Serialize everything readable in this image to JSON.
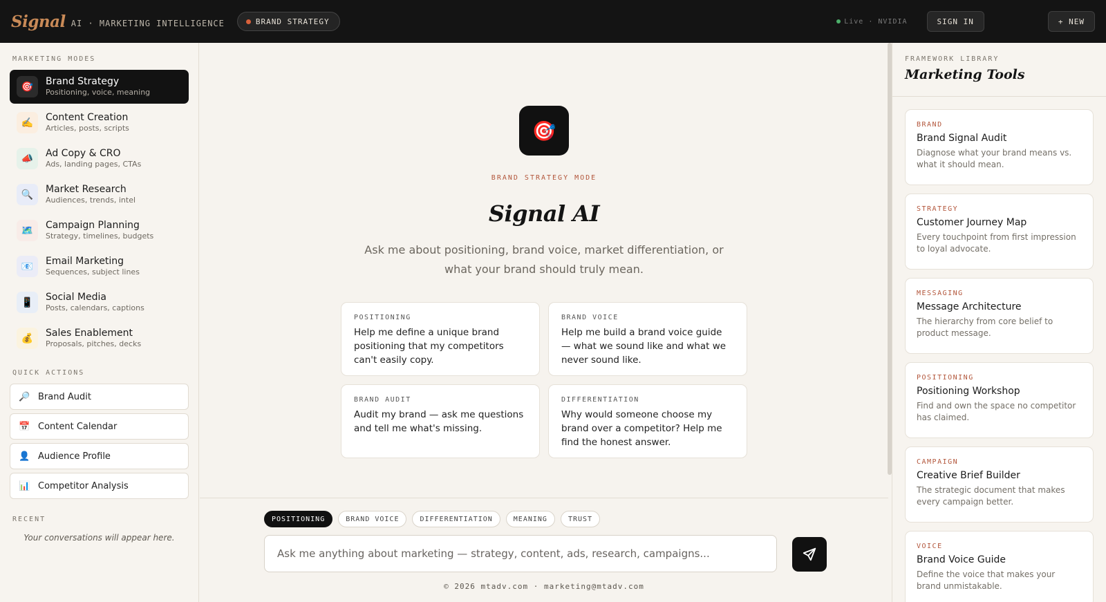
{
  "header": {
    "logo": "Signal",
    "tagline": "AI · MARKETING INTELLIGENCE",
    "mode_pill": "BRAND STRATEGY",
    "status": "Live · NVIDIA",
    "sign_in": "SIGN IN",
    "new_button": "+ NEW"
  },
  "sidebar": {
    "modes_title": "MARKETING MODES",
    "modes": [
      {
        "icon": "🎯",
        "title": "Brand Strategy",
        "subtitle": "Positioning, voice, meaning",
        "active": true,
        "bg": "#2b2b2b"
      },
      {
        "icon": "✍️",
        "title": "Content Creation",
        "subtitle": "Articles, posts, scripts",
        "bg": "#fbeee0"
      },
      {
        "icon": "📣",
        "title": "Ad Copy & CRO",
        "subtitle": "Ads, landing pages, CTAs",
        "bg": "#e6f2ea"
      },
      {
        "icon": "🔍",
        "title": "Market Research",
        "subtitle": "Audiences, trends, intel",
        "bg": "#e8ecf8"
      },
      {
        "icon": "🗺️",
        "title": "Campaign Planning",
        "subtitle": "Strategy, timelines, budgets",
        "bg": "#f8ece8"
      },
      {
        "icon": "📧",
        "title": "Email Marketing",
        "subtitle": "Sequences, subject lines",
        "bg": "#ebecf7"
      },
      {
        "icon": "📱",
        "title": "Social Media",
        "subtitle": "Posts, calendars, captions",
        "bg": "#e8eef7"
      },
      {
        "icon": "💰",
        "title": "Sales Enablement",
        "subtitle": "Proposals, pitches, decks",
        "bg": "#fbf3df"
      }
    ],
    "quick_title": "QUICK ACTIONS",
    "quick_actions": [
      {
        "icon": "🔎",
        "label": "Brand Audit"
      },
      {
        "icon": "📅",
        "label": "Content Calendar"
      },
      {
        "icon": "👤",
        "label": "Audience Profile"
      },
      {
        "icon": "📊",
        "label": "Competitor Analysis"
      }
    ],
    "recent_title": "RECENT",
    "recent_empty": "Your conversations will appear here."
  },
  "main": {
    "hero_icon": "🎯",
    "mode_label": "BRAND STRATEGY MODE",
    "title": "Signal AI",
    "subtitle": "Ask me about positioning, brand voice, market differentiation, or what your brand should truly mean.",
    "prompts": [
      {
        "label": "POSITIONING",
        "text": "Help me define a unique brand positioning that my competitors can't easily copy."
      },
      {
        "label": "BRAND VOICE",
        "text": "Help me build a brand voice guide — what we sound like and what we never sound like."
      },
      {
        "label": "BRAND AUDIT",
        "text": "Audit my brand — ask me questions and tell me what's missing."
      },
      {
        "label": "DIFFERENTIATION",
        "text": "Why would someone choose my brand over a competitor? Help me find the honest answer."
      }
    ],
    "chips": [
      "POSITIONING",
      "BRAND VOICE",
      "DIFFERENTIATION",
      "MEANING",
      "TRUST"
    ],
    "input_placeholder": "Ask me anything about marketing — strategy, content, ads, research, campaigns...",
    "footer": "© 2026 mtadv.com · marketing@mtadv.com"
  },
  "tools_panel": {
    "kicker": "FRAMEWORK LIBRARY",
    "title": "Marketing Tools",
    "tools": [
      {
        "category": "BRAND",
        "title": "Brand Signal Audit",
        "desc": "Diagnose what your brand means vs. what it should mean."
      },
      {
        "category": "STRATEGY",
        "title": "Customer Journey Map",
        "desc": "Every touchpoint from first impression to loyal advocate."
      },
      {
        "category": "MESSAGING",
        "title": "Message Architecture",
        "desc": "The hierarchy from core belief to product message."
      },
      {
        "category": "POSITIONING",
        "title": "Positioning Workshop",
        "desc": "Find and own the space no competitor has claimed."
      },
      {
        "category": "CAMPAIGN",
        "title": "Creative Brief Builder",
        "desc": "The strategic document that makes every campaign better."
      },
      {
        "category": "VOICE",
        "title": "Brand Voice Guide",
        "desc": "Define the voice that makes your brand unmistakable."
      }
    ]
  }
}
